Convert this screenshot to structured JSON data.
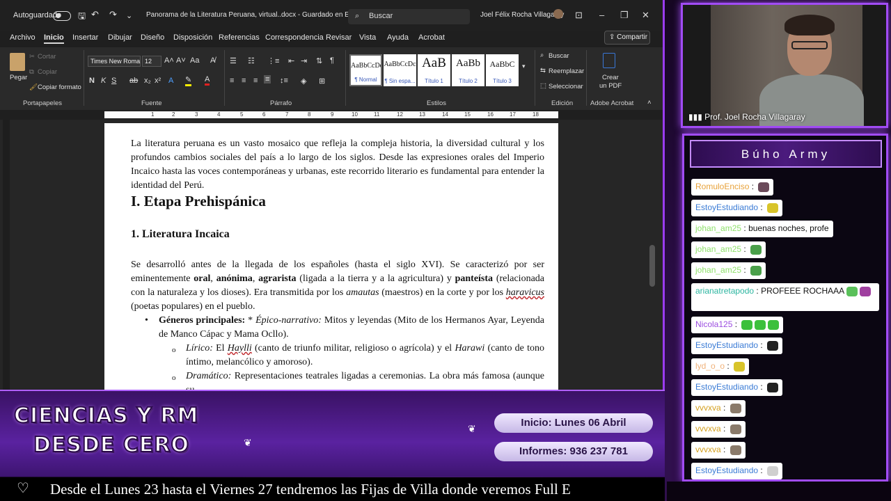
{
  "word": {
    "autosave_label": "Autoguardado",
    "doc_title": "Panorama de la Literatura Peruana, virtual..docx  -  Guardado en Este PC ▾",
    "search_placeholder": "Buscar",
    "user_name": "Joel Félix Rocha Villagaray",
    "menu": [
      "Archivo",
      "Inicio",
      "Insertar",
      "Dibujar",
      "Diseño",
      "Disposición",
      "Referencias",
      "Correspondencia",
      "Revisar",
      "Vista",
      "Ayuda",
      "Acrobat"
    ],
    "share_label": "Compartir",
    "ribbon": {
      "paste": "Pegar",
      "cut": "Cortar",
      "copy": "Copiar",
      "format_painter": "Copiar formato",
      "font_name": "Times New Roma",
      "font_size": "12",
      "styles": [
        {
          "preview": "AaBbCcDc",
          "name": "¶ Normal"
        },
        {
          "preview": "AaBbCcDc",
          "name": "¶ Sin espa..."
        },
        {
          "preview": "AaB",
          "name": "Título 1"
        },
        {
          "preview": "AaBb",
          "name": "Título 2"
        },
        {
          "preview": "AaBbC",
          "name": "Título 3"
        }
      ],
      "find": "Buscar",
      "replace": "Reemplazar",
      "select": "Seleccionar",
      "create_pdf_line1": "Crear",
      "create_pdf_line2": "un PDF",
      "groups": {
        "clipboard": "Portapapeles",
        "font": "Fuente",
        "paragraph": "Párrafo",
        "styles": "Estilos",
        "editing": "Edición",
        "acrobat": "Adobe Acrobat"
      }
    },
    "ruler_numbers": [
      "1",
      "2",
      "3",
      "4",
      "5",
      "6",
      "7",
      "8",
      "9",
      "10",
      "11",
      "12",
      "13",
      "14",
      "15",
      "16",
      "17",
      "18"
    ],
    "document": {
      "intro": "La literatura peruana es un vasto mosaico que refleja la compleja historia, la diversidad cultural y los profundos cambios sociales del país a lo largo de los siglos. Desde las expresiones orales del Imperio Incaico hasta las voces contemporáneas y urbanas, este recorrido literario es fundamental para entender la identidad del Perú.",
      "heading1": "I. Etapa Prehispánica",
      "heading2": "1. Literatura Incaica",
      "para": {
        "p1": "Se desarrolló antes de la llegada de los españoles (hasta el siglo XVI). Se caracterizó por ser eminentemente ",
        "b1": "oral",
        "p2": ", ",
        "b2": "anónima",
        "p3": ", ",
        "b3": "agrarista",
        "p4": " (ligada a la tierra y a la agricultura) y ",
        "b4": "panteísta",
        "p5": " (relacionada con la naturaleza y los dioses). Era transmitida por los ",
        "i1": "amautas",
        "p6": " (maestros) en la corte y por los ",
        "i2": "haravicus",
        "p7": " (poetas populares) en el pueblo."
      },
      "bullet": {
        "bold": "Géneros principales:",
        "star": " * ",
        "ital": "Épico-narrativo:",
        "rest": " Mitos y leyendas (Mito de los Hermanos Ayar, Leyenda de Manco Cápac y Mama Ocllo)."
      },
      "sub1": {
        "ital": "Lírico:",
        "p1": " El ",
        "ital2": "Haylli",
        "p2": " (canto de triunfo militar, religioso o agrícola) y el ",
        "ital3": "Harawi",
        "p3": " (canto de tono íntimo, melancólico y amoroso)."
      },
      "sub2": {
        "ital": "Dramático:",
        "rest": " Representaciones teatrales ligadas a ceremonias. La obra más famosa (aunque su"
      }
    }
  },
  "webcam": {
    "label": "Prof. Joel Rocha Villagaray"
  },
  "chat": {
    "title": "Búho Army",
    "messages": [
      {
        "user": "RomuloEnciso",
        "text": "",
        "user_color": "#e8a23a",
        "emotes": [
          "#6b4a5a"
        ]
      },
      {
        "user": "EstoyEstudiando",
        "text": "",
        "user_color": "#3a7bd5",
        "emotes": [
          "#d8c42a"
        ]
      },
      {
        "user": "johan_am25",
        "text": "buenas noches, profe",
        "user_color": "#8ee06a",
        "emotes": []
      },
      {
        "user": "johan_am25",
        "text": "",
        "user_color": "#8ee06a",
        "emotes": [
          "#4aa04a"
        ]
      },
      {
        "user": "johan_am25",
        "text": "",
        "user_color": "#8ee06a",
        "emotes": [
          "#4aa04a"
        ]
      },
      {
        "user": "arianatretapodo",
        "text": "PROFEEE ROCHAAA",
        "user_color": "#2bb5a0",
        "emotes": [
          "#5ac05a",
          "#a040a0"
        ]
      },
      {
        "user": "Nicola125",
        "text": "",
        "user_color": "#9b4de0",
        "emotes": [
          "#3cc03c",
          "#3cc03c",
          "#3cc03c"
        ]
      },
      {
        "user": "EstoyEstudiando",
        "text": "",
        "user_color": "#3a7bd5",
        "emotes": [
          "#222222"
        ]
      },
      {
        "user": "lyd_o_o",
        "text": "",
        "user_color": "#f0b27a",
        "emotes": [
          "#d8c42a"
        ]
      },
      {
        "user": "EstoyEstudiando",
        "text": "",
        "user_color": "#3a7bd5",
        "emotes": [
          "#222222"
        ]
      },
      {
        "user": "vvvxva",
        "text": "",
        "user_color": "#d4a020",
        "emotes": [
          "#8a7a6a"
        ]
      },
      {
        "user": "vvvxva",
        "text": "",
        "user_color": "#d4a020",
        "emotes": [
          "#8a7a6a"
        ]
      },
      {
        "user": "vvvxva",
        "text": "",
        "user_color": "#d4a020",
        "emotes": [
          "#8a7a6a"
        ]
      },
      {
        "user": "EstoyEstudiando",
        "text": "",
        "user_color": "#3a7bd5",
        "emotes": [
          "#cfcfcf"
        ]
      }
    ]
  },
  "banner": {
    "brand_line1": "CIENCIAS Y RM",
    "brand_line2": "DESDE CERO",
    "start": "Inicio: Lunes 06 Abril",
    "info": "Informes: 936 237 781"
  },
  "ticker": {
    "icon": "♡",
    "text": "Desde el Lunes 23 hasta el Viernes 27 tendremos las Fijas de Villa donde veremos Full E"
  },
  "colors": {
    "accent": "#a14cf4",
    "word_dark": "#1f1f1f",
    "banner_purple": "#5a22a0"
  }
}
